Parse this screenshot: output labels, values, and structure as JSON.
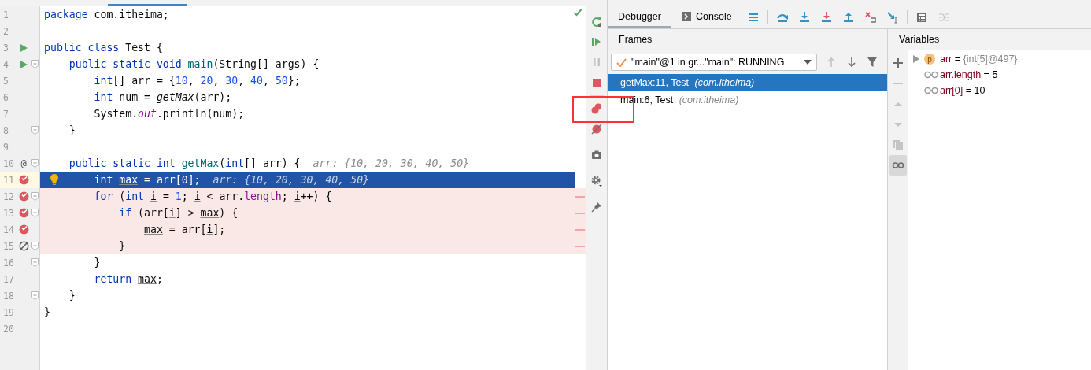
{
  "editor": {
    "lines": [
      {
        "number": "1",
        "fold": false,
        "tokens": [
          {
            "text": "package",
            "kind": "kw"
          },
          {
            "text": " com.itheima;",
            "kind": "plain"
          }
        ]
      },
      {
        "number": "2",
        "fold": false
      },
      {
        "number": "3",
        "gutter": {
          "kind": "run"
        },
        "fold": false,
        "tokens": [
          {
            "text": "public class",
            "kind": "kw"
          },
          {
            "text": " Test {",
            "kind": "plain"
          }
        ]
      },
      {
        "number": "4",
        "gutter": {
          "kind": "run"
        },
        "fold": true,
        "tokens": [
          {
            "text": "    public static void",
            "kind": "kw"
          },
          {
            "text": " main",
            "kind": "decl"
          },
          {
            "text": "(String[] args) {",
            "kind": "plain"
          }
        ]
      },
      {
        "number": "5",
        "fold": false,
        "tokens": [
          {
            "text": "        int",
            "kind": "kw"
          },
          {
            "text": "[] arr = {",
            "kind": "plain"
          },
          {
            "text": "10",
            "kind": "num"
          },
          {
            "text": ", ",
            "kind": "plain"
          },
          {
            "text": "20",
            "kind": "num"
          },
          {
            "text": ", ",
            "kind": "plain"
          },
          {
            "text": "30",
            "kind": "num"
          },
          {
            "text": ", ",
            "kind": "plain"
          },
          {
            "text": "40",
            "kind": "num"
          },
          {
            "text": ", ",
            "kind": "plain"
          },
          {
            "text": "50",
            "kind": "num"
          },
          {
            "text": "};",
            "kind": "plain"
          }
        ]
      },
      {
        "number": "6",
        "fold": false,
        "tokens": [
          {
            "text": "        int",
            "kind": "kw"
          },
          {
            "text": " num = ",
            "kind": "plain"
          },
          {
            "text": "getMax",
            "kind": "call"
          },
          {
            "text": "(arr);",
            "kind": "plain"
          }
        ]
      },
      {
        "number": "7",
        "fold": false,
        "tokens": [
          {
            "text": "        System.",
            "kind": "plain"
          },
          {
            "text": "out",
            "kind": "static"
          },
          {
            "text": ".println(num);",
            "kind": "plain"
          }
        ]
      },
      {
        "number": "8",
        "fold": true,
        "tokens": [
          {
            "text": "    }",
            "kind": "plain"
          }
        ]
      },
      {
        "number": "9",
        "fold": false
      },
      {
        "number": "10",
        "gutter": {
          "kind": "override",
          "text": "@"
        },
        "fold": true,
        "tokens": [
          {
            "text": "    public static int",
            "kind": "kw"
          },
          {
            "text": " getMax",
            "kind": "decl"
          },
          {
            "text": "(",
            "kind": "plain"
          },
          {
            "text": "int",
            "kind": "kw"
          },
          {
            "text": "[] arr) {",
            "kind": "plain"
          },
          {
            "text": "arr: {10, 20, 30, 40, 50}",
            "kind": "hint"
          }
        ]
      },
      {
        "number": "11",
        "kind": "current",
        "gutter": {
          "kind": "breakpoint"
        },
        "fold": false,
        "bulb": true,
        "tokens": [
          {
            "text": "        int ",
            "kind": "kw"
          },
          {
            "text": "max",
            "kind": "local"
          },
          {
            "text": " = arr[0];",
            "kind": "plain"
          },
          {
            "text": "arr: {10, 20, 30, 40, 50}",
            "kind": "hint"
          }
        ]
      },
      {
        "number": "12",
        "kind": "breakpoint",
        "gutter": {
          "kind": "breakpoint"
        },
        "fold": true,
        "tokens": [
          {
            "text": "        for",
            "kind": "kw"
          },
          {
            "text": " (",
            "kind": "plain"
          },
          {
            "text": "int ",
            "kind": "kw"
          },
          {
            "text": "i",
            "kind": "local"
          },
          {
            "text": " = ",
            "kind": "plain"
          },
          {
            "text": "1",
            "kind": "num"
          },
          {
            "text": "; ",
            "kind": "plain"
          },
          {
            "text": "i",
            "kind": "local"
          },
          {
            "text": " < arr.",
            "kind": "plain"
          },
          {
            "text": "length",
            "kind": "field"
          },
          {
            "text": "; ",
            "kind": "plain"
          },
          {
            "text": "i",
            "kind": "local"
          },
          {
            "text": "++) {",
            "kind": "plain"
          }
        ]
      },
      {
        "number": "13",
        "kind": "breakpoint",
        "gutter": {
          "kind": "breakpoint"
        },
        "fold": true,
        "tokens": [
          {
            "text": "            if",
            "kind": "kw"
          },
          {
            "text": " (arr[",
            "kind": "plain"
          },
          {
            "text": "i",
            "kind": "local"
          },
          {
            "text": "] > ",
            "kind": "plain"
          },
          {
            "text": "max",
            "kind": "local"
          },
          {
            "text": ") {",
            "kind": "plain"
          }
        ]
      },
      {
        "number": "14",
        "kind": "breakpoint",
        "gutter": {
          "kind": "breakpoint"
        },
        "fold": false,
        "tokens": [
          {
            "text": "                max",
            "kind": "local"
          },
          {
            "text": " = arr[",
            "kind": "plain"
          },
          {
            "text": "i",
            "kind": "local"
          },
          {
            "text": "];",
            "kind": "plain"
          }
        ]
      },
      {
        "number": "15",
        "kind": "breakpoint",
        "gutter": {
          "kind": "invalid"
        },
        "fold": true,
        "tokens": [
          {
            "text": "            }",
            "kind": "plain"
          }
        ]
      },
      {
        "number": "16",
        "fold": true,
        "tokens": [
          {
            "text": "        }",
            "kind": "plain"
          }
        ]
      },
      {
        "number": "17",
        "fold": false,
        "tokens": [
          {
            "text": "        return ",
            "kind": "kw"
          },
          {
            "text": "max",
            "kind": "local"
          },
          {
            "text": ";",
            "kind": "plain"
          }
        ]
      },
      {
        "number": "18",
        "fold": true,
        "tokens": [
          {
            "text": "    }",
            "kind": "plain"
          }
        ]
      },
      {
        "number": "19",
        "fold": false,
        "tokens": [
          {
            "text": "}",
            "kind": "plain"
          }
        ]
      },
      {
        "number": "20",
        "fold": false
      }
    ]
  },
  "debug_toolbar": [
    {
      "kind": "rerun",
      "disabled": false
    },
    {
      "kind": "resume",
      "disabled": false
    },
    {
      "kind": "pause",
      "disabled": true
    },
    {
      "kind": "stop",
      "disabled": false
    },
    {
      "kind": "breakpoints",
      "disabled": false
    },
    {
      "kind": "mute",
      "disabled": false
    },
    {
      "kind": "camera",
      "disabled": false
    },
    {
      "kind": "settings",
      "disabled": false
    },
    {
      "kind": "pin",
      "disabled": false
    }
  ],
  "debugger": {
    "tabs": [
      {
        "label": "Debugger",
        "kind": "plain",
        "selected": true
      },
      {
        "label": "Console",
        "kind": "console",
        "selected": false
      }
    ],
    "actions": [
      {
        "kind": "list",
        "disabled": false
      },
      {
        "kind": "step-over",
        "disabled": false
      },
      {
        "kind": "step-into",
        "disabled": false
      },
      {
        "kind": "force-step-into",
        "disabled": false
      },
      {
        "kind": "step-out",
        "disabled": false
      },
      {
        "kind": "drop-frame",
        "disabled": false
      },
      {
        "kind": "run-to-cursor",
        "disabled": false
      },
      {
        "kind": "evaluate",
        "disabled": false
      },
      {
        "kind": "trace",
        "disabled": true
      }
    ],
    "frames": {
      "title": "Frames",
      "thread": "\"main\"@1 in gr...\"main\": RUNNING",
      "nav": [
        {
          "kind": "up",
          "disabled": true
        },
        {
          "kind": "down",
          "disabled": false
        },
        {
          "kind": "filter",
          "disabled": false
        }
      ],
      "items": [
        {
          "method": "getMax:11, Test",
          "package": "(com.itheima)",
          "selected": true
        },
        {
          "method": "main:6, Test",
          "package": "(com.itheima)",
          "selected": false
        }
      ]
    },
    "variables": {
      "title": "Variables",
      "tools": [
        {
          "kind": "plus",
          "disabled": false,
          "selected": false
        },
        {
          "kind": "minus",
          "disabled": true,
          "selected": false
        },
        {
          "kind": "up",
          "disabled": true,
          "selected": false
        },
        {
          "kind": "down",
          "disabled": true,
          "selected": false
        },
        {
          "kind": "copy",
          "disabled": true,
          "selected": false
        },
        {
          "kind": "watches",
          "disabled": false,
          "selected": true
        }
      ],
      "items": [
        {
          "kind": "object",
          "badge": "p",
          "name": "arr",
          "sign": "=",
          "value": "{int[5]@497}"
        },
        {
          "kind": "watch",
          "name": "arr.length",
          "sign": "=",
          "value": "5"
        },
        {
          "kind": "watch",
          "name": "arr[0]",
          "sign": "=",
          "value": "10"
        }
      ]
    }
  }
}
